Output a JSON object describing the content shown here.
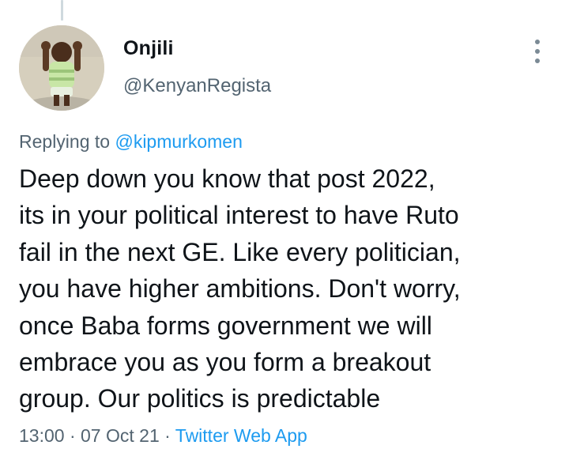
{
  "tweet": {
    "author": {
      "display_name": "Onjili",
      "handle": "@KenyanRegista"
    },
    "replying_to_prefix": "Replying to",
    "replying_to_handle": "@kipmurkomen",
    "text_lines": [
      "Deep down you know that post 2022,",
      "its in your political interest to have Ruto",
      "fail in the next GE. Like every politician,",
      "you have higher ambitions. Don't worry,",
      "once Baba forms government we will",
      "embrace you as you form a breakout",
      "group. Our politics is predictable"
    ],
    "time": "13:00",
    "separator": "·",
    "date": "07 Oct 21",
    "source": "Twitter Web App"
  },
  "icons": {
    "more": "more-options-icon",
    "avatar": "avatar-photo"
  },
  "colors": {
    "text": "#0f1419",
    "secondary": "#536471",
    "link": "#1d9bf0",
    "thread_line": "#cfd9de"
  }
}
